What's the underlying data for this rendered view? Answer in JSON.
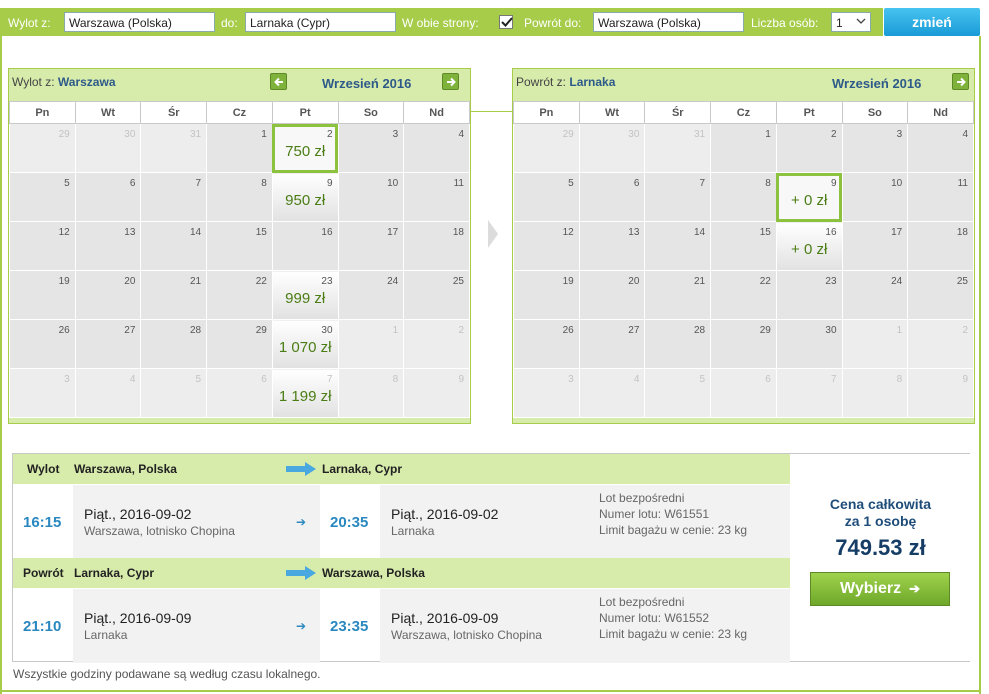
{
  "search": {
    "from_label": "Wylot z:",
    "from_value": "Warszawa (Polska)",
    "to_label": "do:",
    "to_value": "Larnaka (Cypr)",
    "round_trip_label": "W obie strony:",
    "round_trip_checked": true,
    "return_label": "Powrót do:",
    "return_value": "Warszawa (Polska)",
    "persons_label": "Liczba osób:",
    "persons_value": "1",
    "change_button": "zmień"
  },
  "weekdays": [
    "Pn",
    "Wt",
    "Śr",
    "Cz",
    "Pt",
    "So",
    "Nd"
  ],
  "calendar_out": {
    "title_prefix": "Wylot z:",
    "title_city": "Warszawa",
    "month": "Wrzesień 2016",
    "weeks": [
      [
        {
          "d": "29",
          "out": true
        },
        {
          "d": "30",
          "out": true
        },
        {
          "d": "31",
          "out": true
        },
        {
          "d": "1"
        },
        {
          "d": "2",
          "price": "750 zł",
          "selected": true
        },
        {
          "d": "3"
        },
        {
          "d": "4"
        }
      ],
      [
        {
          "d": "5"
        },
        {
          "d": "6"
        },
        {
          "d": "7"
        },
        {
          "d": "8"
        },
        {
          "d": "9",
          "price": "950 zł"
        },
        {
          "d": "10"
        },
        {
          "d": "11"
        }
      ],
      [
        {
          "d": "12"
        },
        {
          "d": "13"
        },
        {
          "d": "14"
        },
        {
          "d": "15"
        },
        {
          "d": "16"
        },
        {
          "d": "17"
        },
        {
          "d": "18"
        }
      ],
      [
        {
          "d": "19"
        },
        {
          "d": "20"
        },
        {
          "d": "21"
        },
        {
          "d": "22"
        },
        {
          "d": "23",
          "price": "999 zł"
        },
        {
          "d": "24"
        },
        {
          "d": "25"
        }
      ],
      [
        {
          "d": "26"
        },
        {
          "d": "27"
        },
        {
          "d": "28"
        },
        {
          "d": "29"
        },
        {
          "d": "30",
          "price": "1 070 zł"
        },
        {
          "d": "1",
          "out": true
        },
        {
          "d": "2",
          "out": true
        }
      ],
      [
        {
          "d": "3",
          "out": true
        },
        {
          "d": "4",
          "out": true
        },
        {
          "d": "5",
          "out": true
        },
        {
          "d": "6",
          "out": true
        },
        {
          "d": "7",
          "out": true,
          "price": "1 199 zł"
        },
        {
          "d": "8",
          "out": true
        },
        {
          "d": "9",
          "out": true
        }
      ]
    ]
  },
  "calendar_return": {
    "title_prefix": "Powrót z:",
    "title_city": "Larnaka",
    "month": "Wrzesień 2016",
    "weeks": [
      [
        {
          "d": "29",
          "out": true
        },
        {
          "d": "30",
          "out": true
        },
        {
          "d": "31",
          "out": true
        },
        {
          "d": "1"
        },
        {
          "d": "2"
        },
        {
          "d": "3"
        },
        {
          "d": "4"
        }
      ],
      [
        {
          "d": "5"
        },
        {
          "d": "6"
        },
        {
          "d": "7"
        },
        {
          "d": "8"
        },
        {
          "d": "9",
          "price": "+ 0 zł",
          "selected": true
        },
        {
          "d": "10"
        },
        {
          "d": "11"
        }
      ],
      [
        {
          "d": "12"
        },
        {
          "d": "13"
        },
        {
          "d": "14"
        },
        {
          "d": "15"
        },
        {
          "d": "16",
          "price": "+ 0 zł"
        },
        {
          "d": "17"
        },
        {
          "d": "18"
        }
      ],
      [
        {
          "d": "19"
        },
        {
          "d": "20"
        },
        {
          "d": "21"
        },
        {
          "d": "22"
        },
        {
          "d": "23"
        },
        {
          "d": "24"
        },
        {
          "d": "25"
        }
      ],
      [
        {
          "d": "26"
        },
        {
          "d": "27"
        },
        {
          "d": "28"
        },
        {
          "d": "29"
        },
        {
          "d": "30"
        },
        {
          "d": "1",
          "out": true
        },
        {
          "d": "2",
          "out": true
        }
      ],
      [
        {
          "d": "3",
          "out": true
        },
        {
          "d": "4",
          "out": true
        },
        {
          "d": "5",
          "out": true
        },
        {
          "d": "6",
          "out": true
        },
        {
          "d": "7",
          "out": true
        },
        {
          "d": "8",
          "out": true
        },
        {
          "d": "9",
          "out": true
        }
      ]
    ]
  },
  "outbound": {
    "label": "Wylot",
    "from": "Warszawa, Polska",
    "to": "Larnaka, Cypr",
    "dep_time": "16:15",
    "dep_day": "Piąt., 2016-09-02",
    "dep_place": "Warszawa, lotnisko Chopina",
    "arr_time": "20:35",
    "arr_day": "Piąt., 2016-09-02",
    "arr_place": "Larnaka",
    "info1": "Lot bezpośredni",
    "info2": "Numer lotu: W61551",
    "info3": "Limit bagażu w cenie: 23 kg"
  },
  "return": {
    "label": "Powrót",
    "from": "Larnaka, Cypr",
    "to": "Warszawa, Polska",
    "dep_time": "21:10",
    "dep_day": "Piąt., 2016-09-09",
    "dep_place": "Larnaka",
    "arr_time": "23:35",
    "arr_day": "Piąt., 2016-09-09",
    "arr_place": "Warszawa, lotnisko Chopina",
    "info1": "Lot bezpośredni",
    "info2": "Numer lotu: W61552",
    "info3": "Limit bagażu w cenie: 23 kg"
  },
  "price": {
    "label_line1": "Cena całkowita",
    "label_line2": "za 1 osobę",
    "total": "749.53 zł",
    "choose_button": "Wybierz"
  },
  "footnote": "Wszystkie godziny podawane są według czasu lokalnego.",
  "colors": {
    "accent_green": "#a6cc4a",
    "price_green": "#4b7d15",
    "time_blue": "#2988c0",
    "button_blue": "#1a9bd6"
  }
}
